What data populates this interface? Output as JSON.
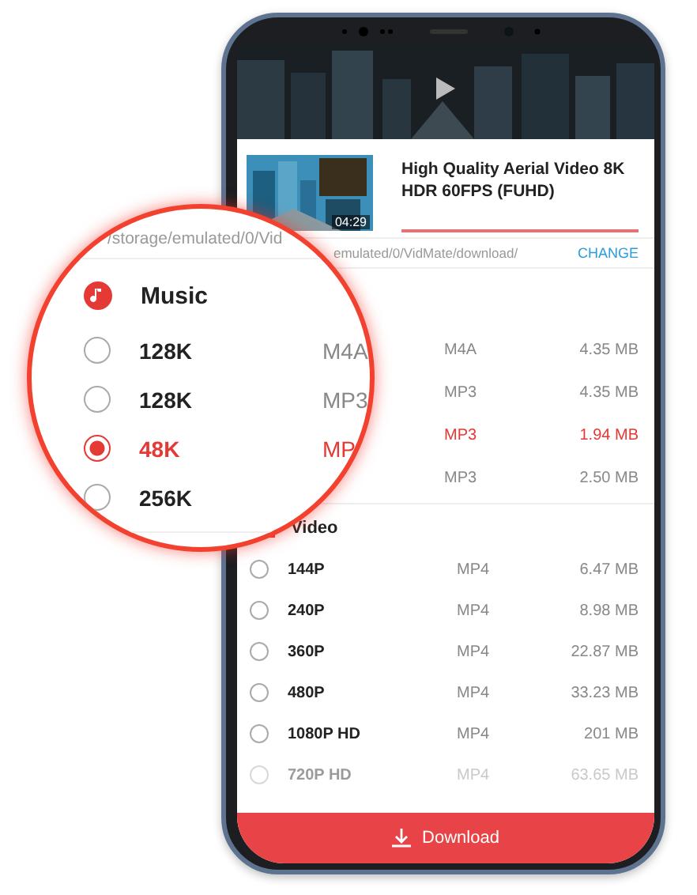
{
  "media": {
    "title": "High Quality Aerial Video 8K HDR 60FPS (FUHD)",
    "duration": "04:29"
  },
  "save_path": {
    "path": "emulated/0/VidMate/download/",
    "action": "CHANGE"
  },
  "music": {
    "options": [
      {
        "format": "M4A",
        "size": "4.35 MB",
        "selected": false
      },
      {
        "format": "MP3",
        "size": "4.35 MB",
        "selected": false
      },
      {
        "format": "MP3",
        "size": "1.94 MB",
        "selected": true
      },
      {
        "format": "MP3",
        "size": "2.50 MB",
        "selected": false
      }
    ]
  },
  "video": {
    "label": "Video",
    "options": [
      {
        "label": "144P",
        "format": "MP4",
        "size": "6.47 MB",
        "selected": false
      },
      {
        "label": "240P",
        "format": "MP4",
        "size": "8.98 MB",
        "selected": false
      },
      {
        "label": "360P",
        "format": "MP4",
        "size": "22.87 MB",
        "selected": false
      },
      {
        "label": "480P",
        "format": "MP4",
        "size": "33.23 MB",
        "selected": false
      },
      {
        "label": "1080P HD",
        "format": "MP4",
        "size": "201 MB",
        "selected": false
      },
      {
        "label": "720P HD",
        "format": "MP4",
        "size": "63.65 MB",
        "selected": false
      }
    ]
  },
  "download_button": "Download",
  "magnifier": {
    "path": "/storage/emulated/0/Vid",
    "label": "Music",
    "options": [
      {
        "label": "128K",
        "format": "M4A",
        "selected": false
      },
      {
        "label": "128K",
        "format": "MP3",
        "selected": false
      },
      {
        "label": "48K",
        "format": "MP",
        "selected": true
      },
      {
        "label": "256K",
        "selected": false
      }
    ]
  }
}
